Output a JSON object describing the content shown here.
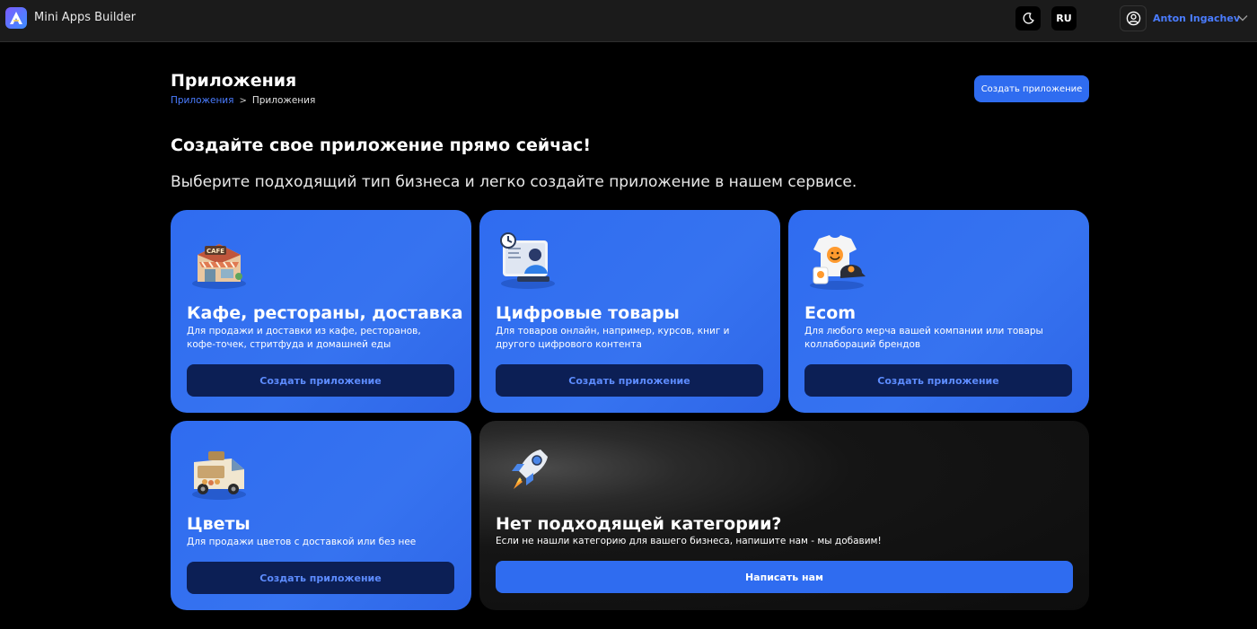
{
  "header": {
    "app_name": "Mini Apps Builder",
    "lang": "RU",
    "user_name": "Anton Ingachev"
  },
  "page": {
    "title": "Приложения",
    "breadcrumb": {
      "link": "Приложения",
      "separator": ">",
      "current": "Приложения"
    },
    "create_button": "Создать приложение",
    "headline": "Создайте свое приложение прямо сейчас!",
    "subline": "Выберите подходящий тип бизнеса и легко создайте приложение в нашем сервисе."
  },
  "cards": [
    {
      "title": "Кафе, рестораны, доставка",
      "desc": "Для продажи и доставки из кафе, ресторанов, кофе-точек, стритфуда и домашней еды",
      "button": "Создать приложение",
      "illustration_icon": "cafe-icon"
    },
    {
      "title": "Цифровые товары",
      "desc": "Для товаров онлайн, например, курсов, книг и другого цифрового контента",
      "button": "Создать приложение",
      "illustration_icon": "online-course-icon"
    },
    {
      "title": "Ecom",
      "desc": "Для любого мерча вашей компании или товары коллабораций брендов",
      "button": "Создать приложение",
      "illustration_icon": "merch-icon"
    },
    {
      "title": "Цветы",
      "desc": "Для продажи цветов с доставкой или без нее",
      "button": "Создать приложение",
      "illustration_icon": "flower-van-icon"
    }
  ],
  "custom_card": {
    "title": "Нет подходящей категории?",
    "desc": "Если не нашли категорию для вашего бизнеса, напишите нам - мы добавим!",
    "button": "Написать нам",
    "illustration_icon": "rocket-icon"
  },
  "colors": {
    "accent": "#2f6cf0",
    "link": "#4a7cff",
    "card_button_bg": "#0c1f55",
    "background": "#000000",
    "topbar": "#1b1b1b"
  }
}
